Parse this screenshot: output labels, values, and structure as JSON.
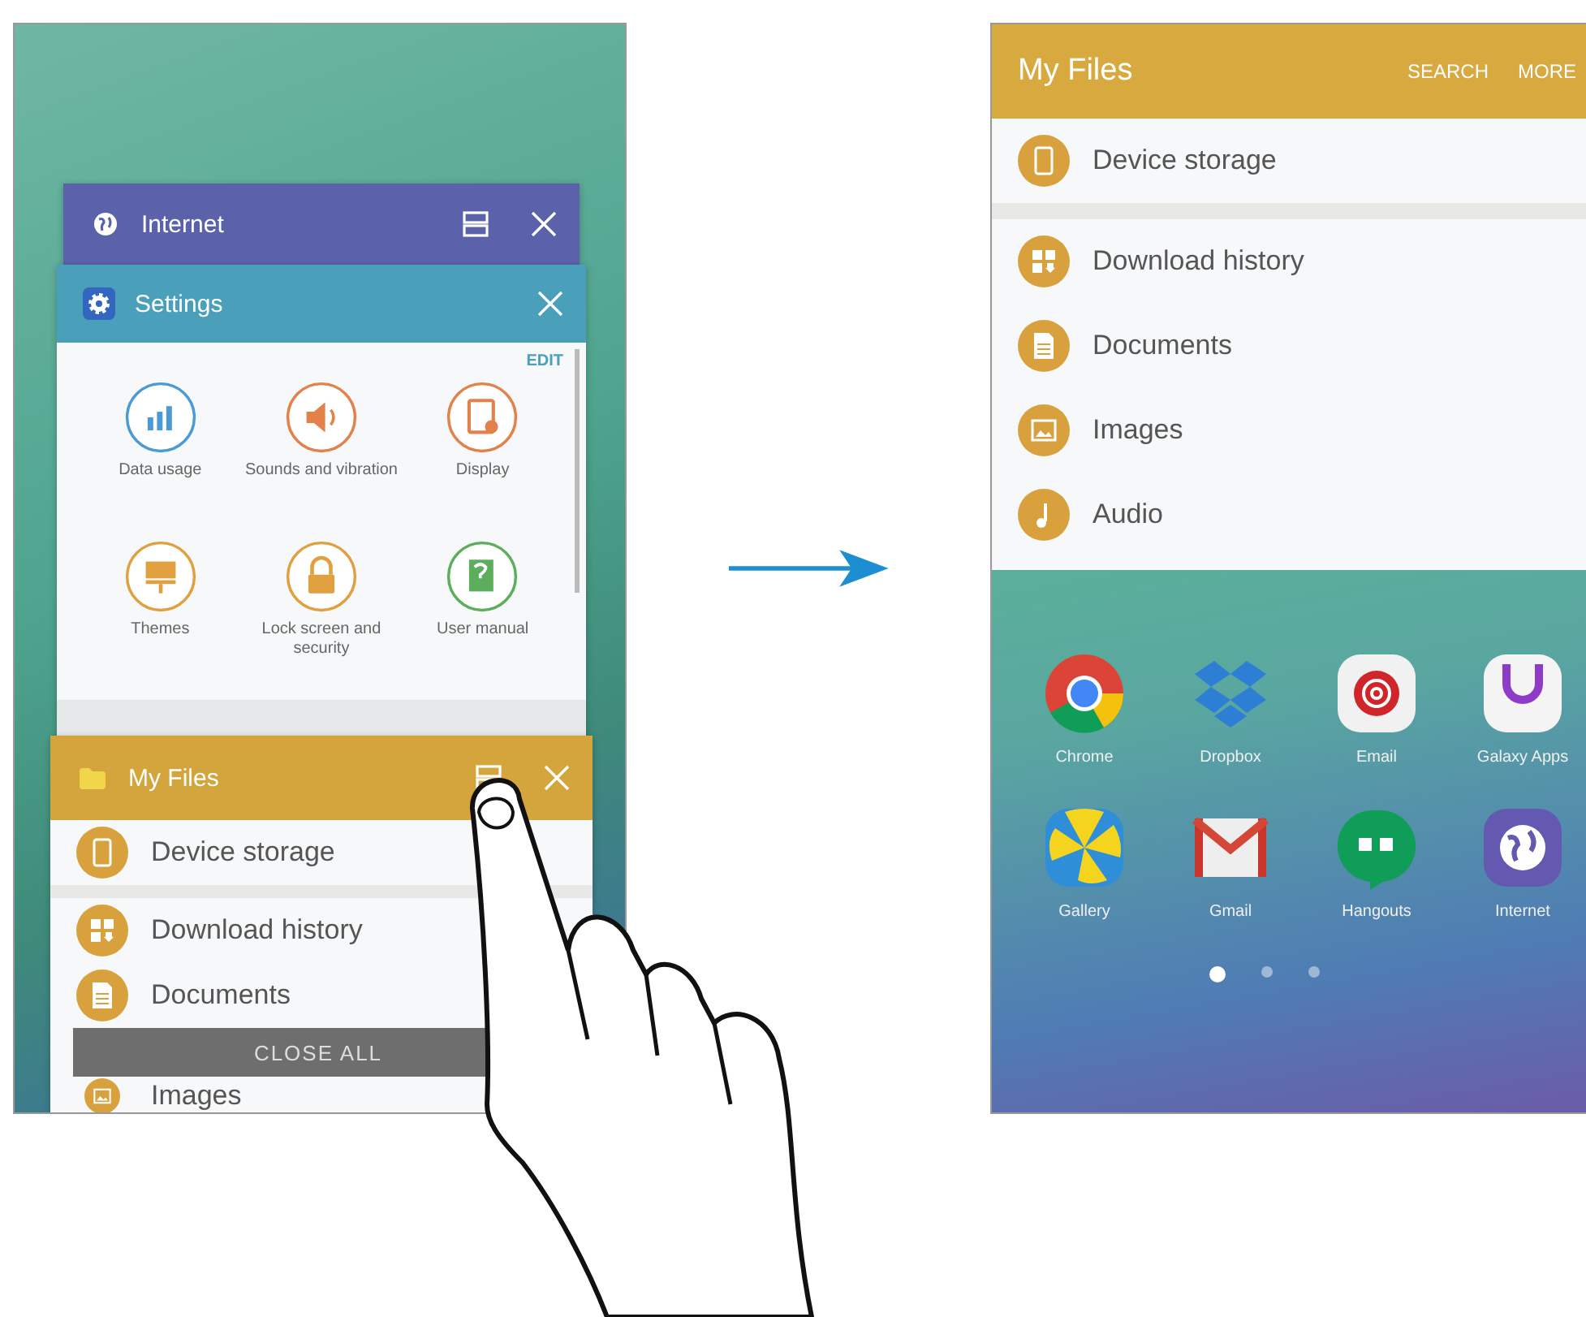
{
  "left_screen": {
    "internet_card": {
      "title": "Internet"
    },
    "settings_card": {
      "title": "Settings",
      "edit": "EDIT",
      "items": [
        {
          "label": "Data usage",
          "kind": "bars",
          "color": "#4a9ad6"
        },
        {
          "label": "Sounds and vibration",
          "kind": "speaker",
          "color": "#e2824a"
        },
        {
          "label": "Display",
          "kind": "display",
          "color": "#e2824a"
        },
        {
          "label": "Themes",
          "kind": "brush",
          "color": "#e0a040"
        },
        {
          "label": "Lock screen and security",
          "kind": "lock",
          "color": "#e0a040"
        },
        {
          "label": "User manual",
          "kind": "book",
          "color": "#5cae5c"
        }
      ]
    },
    "myfiles_card": {
      "title": "My Files",
      "rows": [
        {
          "label": "Device storage",
          "kind": "phone"
        },
        {
          "label": "Download history",
          "kind": "download"
        },
        {
          "label": "Documents",
          "kind": "document"
        }
      ],
      "close_all": "CLOSE ALL",
      "last_row": {
        "label": "Images",
        "kind": "image"
      }
    }
  },
  "right_screen": {
    "app_bar": {
      "title": "My Files",
      "actions": [
        "SEARCH",
        "MORE"
      ]
    },
    "storage": {
      "label": "Device storage",
      "kind": "phone"
    },
    "categories": [
      {
        "label": "Download history",
        "kind": "download"
      },
      {
        "label": "Documents",
        "kind": "document"
      },
      {
        "label": "Images",
        "kind": "image"
      },
      {
        "label": "Audio",
        "kind": "note"
      }
    ],
    "apps": [
      {
        "label": "Chrome",
        "kind": "chrome"
      },
      {
        "label": "Dropbox",
        "kind": "dropbox"
      },
      {
        "label": "Email",
        "kind": "email"
      },
      {
        "label": "Galaxy Apps",
        "kind": "galaxy"
      },
      {
        "label": "Gallery",
        "kind": "gallery"
      },
      {
        "label": "Gmail",
        "kind": "gmail"
      },
      {
        "label": "Hangouts",
        "kind": "hangouts"
      },
      {
        "label": "Internet",
        "kind": "internet"
      }
    ],
    "pages": [
      {
        "selected": true
      },
      {
        "selected": false
      },
      {
        "selected": false
      }
    ]
  }
}
